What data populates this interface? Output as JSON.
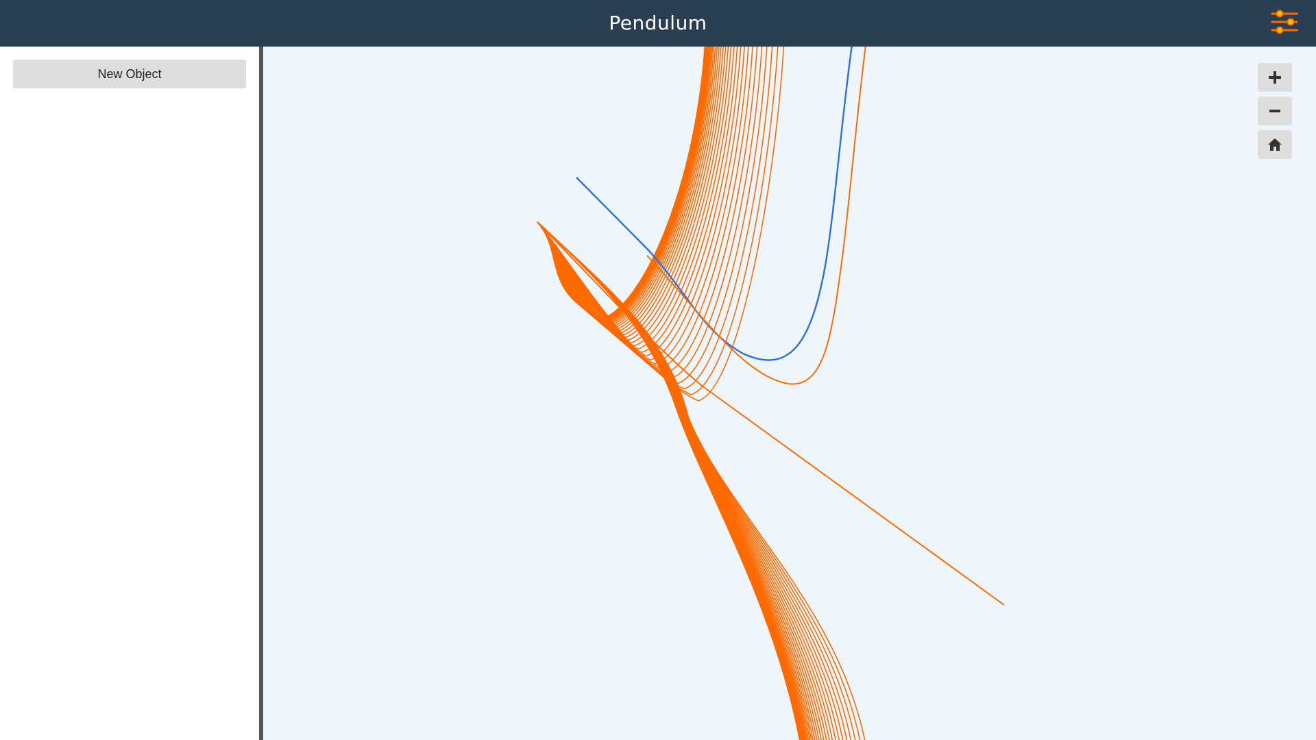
{
  "header": {
    "title": "Pendulum",
    "settings_icon": "sliders-icon"
  },
  "sidebar": {
    "new_object_label": "New Object"
  },
  "canvas": {
    "background": "#eef6fc",
    "zoom_in_icon": "plus-icon",
    "zoom_out_icon": "minus-icon",
    "home_icon": "home-icon"
  },
  "colors": {
    "header_bg": "#2b3f53",
    "orange": "#ff6a00",
    "blue": "#2b6fe0",
    "button_bg": "#dedede",
    "divider": "#555555"
  }
}
